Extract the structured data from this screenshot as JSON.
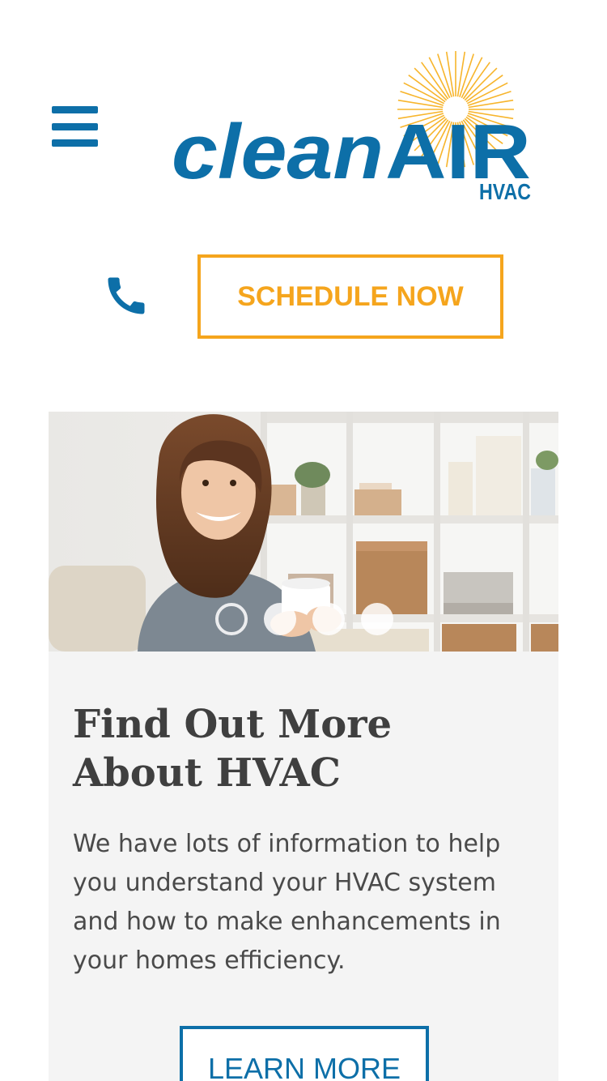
{
  "header": {
    "menu_icon": "hamburger-menu-icon",
    "logo": {
      "wordmark_clean": "clean",
      "wordmark_air": "AIR",
      "tagline": "HVAC",
      "sun_icon": "sunburst-icon"
    },
    "phone_icon": "phone-icon",
    "schedule_label": "SCHEDULE NOW"
  },
  "carousel": {
    "slide_count": 4,
    "active_slide": 1
  },
  "card": {
    "title": "Find Out More About HVAC",
    "text": "We have lots of information to help you understand your HVAC system and how to make enhancements in your homes efficiency.",
    "button_label": "LEARN MORE"
  },
  "colors": {
    "brand_blue": "#0d6fa8",
    "accent_orange": "#f5a51d",
    "sun_yellow": "#f7b52c",
    "card_background": "#f4f4f4",
    "text_dark": "#3f3f3f"
  }
}
